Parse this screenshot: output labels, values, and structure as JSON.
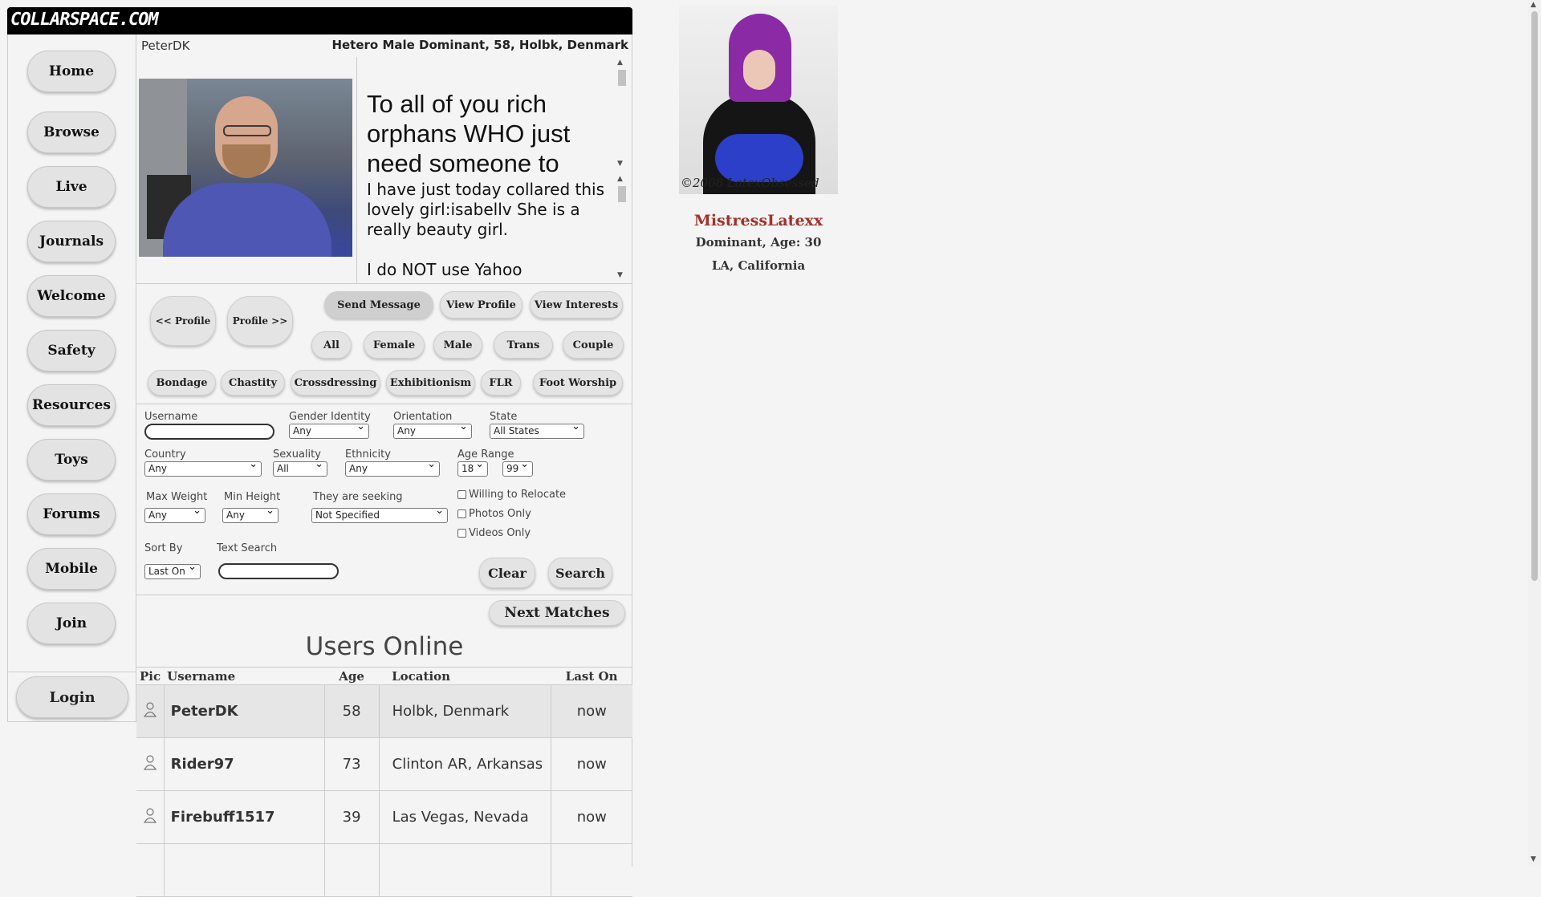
{
  "site": {
    "logo": "COLLARSPACE.COM"
  },
  "nav": {
    "items": [
      "Home",
      "Browse",
      "Live",
      "Journals",
      "Welcome",
      "Safety",
      "Resources",
      "Toys",
      "Forums",
      "Mobile",
      "Join"
    ],
    "login": "Login"
  },
  "profile": {
    "username": "PeterDK",
    "description": "Hetero Male Dominant, 58, Holbk, Denmark",
    "headline": "To all of you rich orphans WHO just need someone to",
    "bio_lines": [
      "I have just today collared this lovely girl:isabellv She is a really beauty girl.",
      "I do NOT use Yahoo"
    ]
  },
  "actions": {
    "prev_profile": "<< Profile",
    "next_profile": "Profile >>",
    "send_message": "Send Message",
    "view_profile": "View Profile",
    "view_interests": "View Interests"
  },
  "gender_filters": [
    "All",
    "Female",
    "Male",
    "Trans",
    "Couple"
  ],
  "interest_tags": [
    "Bondage",
    "Chastity",
    "Crossdressing",
    "Exhibitionism",
    "FLR",
    "Foot Worship"
  ],
  "search": {
    "username_label": "Username",
    "gender_identity_label": "Gender Identity",
    "gender_identity_value": "Any",
    "orientation_label": "Orientation",
    "orientation_value": "Any",
    "state_label": "State",
    "state_value": "All States",
    "country_label": "Country",
    "country_value": "Any",
    "sexuality_label": "Sexuality",
    "sexuality_value": "All",
    "ethnicity_label": "Ethnicity",
    "ethnicity_value": "Any",
    "age_range_label": "Age Range",
    "age_min": "18",
    "age_max": "99",
    "max_weight_label": "Max Weight",
    "max_weight_value": "Any",
    "min_height_label": "Min Height",
    "min_height_value": "Any",
    "seeking_label": "They are seeking",
    "seeking_value": "Not Specified",
    "relocate_label": "Willing to Relocate",
    "photos_label": "Photos Only",
    "videos_label": "Videos Only",
    "sort_label": "Sort By",
    "sort_value": "Last On",
    "text_search_label": "Text Search",
    "clear": "Clear",
    "search": "Search",
    "next_matches": "Next Matches"
  },
  "users_online": {
    "title": "Users Online",
    "columns": [
      "Pic",
      "Username",
      "Age",
      "Location",
      "Last On"
    ],
    "rows": [
      {
        "username": "PeterDK",
        "age": "58",
        "location": "Holbk, Denmark",
        "last_on": "now"
      },
      {
        "username": "Rider97",
        "age": "73",
        "location": "Clinton AR, Arkansas",
        "last_on": "now"
      },
      {
        "username": "Firebuff1517",
        "age": "39",
        "location": "Las Vegas, Nevada",
        "last_on": "now"
      }
    ]
  },
  "featured": {
    "watermark": "©2008 LatexObsessed",
    "name": "MistressLatexx",
    "description": "Dominant, Age: 30",
    "location": "LA, California"
  }
}
